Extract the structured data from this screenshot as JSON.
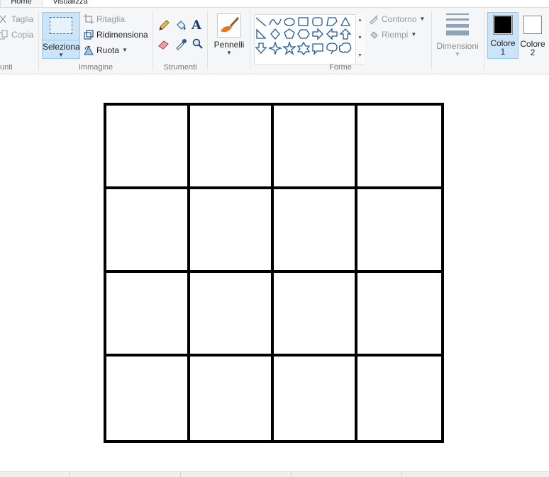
{
  "tabs": {
    "home": "Home",
    "view": "Visualizza"
  },
  "clipboard": {
    "cut": "Taglia",
    "copy": "Copia",
    "group_label": "unti"
  },
  "image": {
    "select": "Seleziona",
    "crop": "Ritaglia",
    "resize": "Ridimensiona",
    "rotate": "Ruota",
    "group_label": "Immagine"
  },
  "tools": {
    "group_label": "Strumenti"
  },
  "brushes": {
    "label": "Pennelli"
  },
  "shapes": {
    "outline": "Contorno",
    "fill": "Riempi",
    "group_label": "Forme",
    "icons": [
      "line-icon",
      "curve-icon",
      "oval-icon",
      "rectangle-icon",
      "rounded-rectangle-icon",
      "polygon-icon",
      "triangle-icon",
      "right-triangle-icon",
      "diamond-icon",
      "pentagon-icon",
      "hexagon-icon",
      "right-arrow-icon",
      "left-arrow-icon",
      "up-arrow-icon",
      "down-arrow-icon",
      "four-point-star-icon",
      "five-point-star-icon",
      "six-point-star-icon",
      "rounded-callout-icon",
      "oval-callout-icon",
      "cloud-callout-icon"
    ]
  },
  "size": {
    "label": "Dimensioni"
  },
  "colors": {
    "color1_label": "Colore",
    "color1_num": "1",
    "color2_label": "Colore",
    "color2_num": "2",
    "color1_value": "#000000",
    "color2_value": "#ffffff"
  },
  "canvas": {
    "grid_rows": 4,
    "grid_cols": 4
  }
}
